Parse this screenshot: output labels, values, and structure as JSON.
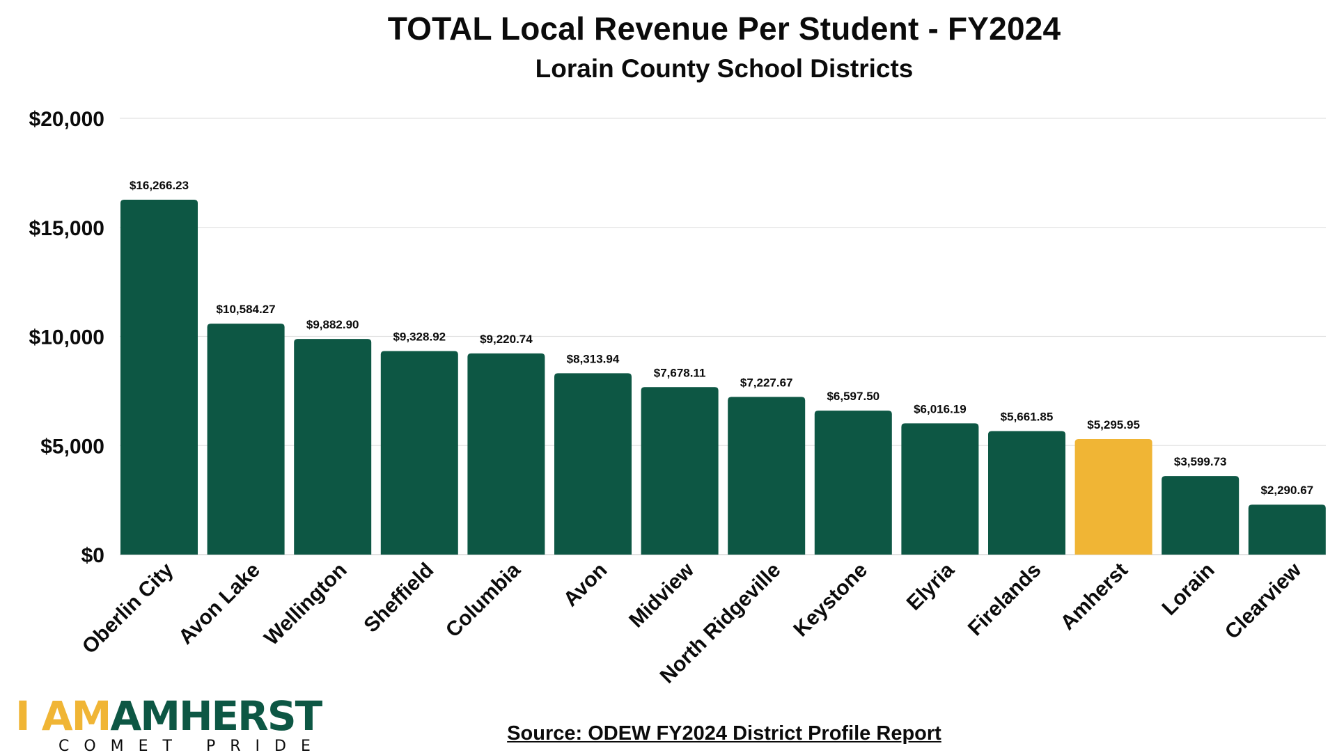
{
  "chart_data": {
    "type": "bar",
    "title": "TOTAL Local Revenue Per Student - FY2024",
    "subtitle": "Lorain County School Districts",
    "categories": [
      "Oberlin City",
      "Avon Lake",
      "Wellington",
      "Sheffield",
      "Columbia",
      "Avon",
      "Midview",
      "North Ridgeville",
      "Keystone",
      "Elyria",
      "Firelands",
      "Amherst",
      "Lorain",
      "Clearview"
    ],
    "values": [
      16266.23,
      10584.27,
      9882.9,
      9328.92,
      9220.74,
      8313.94,
      7678.11,
      7227.67,
      6597.5,
      6016.19,
      5661.85,
      5295.95,
      3599.73,
      2290.67
    ],
    "value_labels": [
      "$16,266.23",
      "$10,584.27",
      "$9,882.90",
      "$9,328.92",
      "$9,220.74",
      "$8,313.94",
      "$7,678.11",
      "$7,227.67",
      "$6,597.50",
      "$6,016.19",
      "$5,661.85",
      "$5,295.95",
      "$3,599.73",
      "$2,290.67"
    ],
    "highlight_category": "Amherst",
    "ylim": [
      0,
      20000
    ],
    "yticks": [
      0,
      5000,
      10000,
      15000,
      20000
    ],
    "ytick_labels": [
      "$0",
      "$5,000",
      "$10,000",
      "$15,000",
      "$20,000"
    ],
    "xlabel": "",
    "ylabel": "",
    "grid": true,
    "colors": {
      "bar": "#0d5744",
      "highlight": "#f0b535",
      "grid": "#e2e2e2",
      "text": "#0b0b0b"
    }
  },
  "source": "Source: ODEW FY2024 District Profile Report",
  "logo": {
    "main_left": "I AM",
    "main_right": "AMHERST",
    "tagline": "COMET PRIDE"
  }
}
